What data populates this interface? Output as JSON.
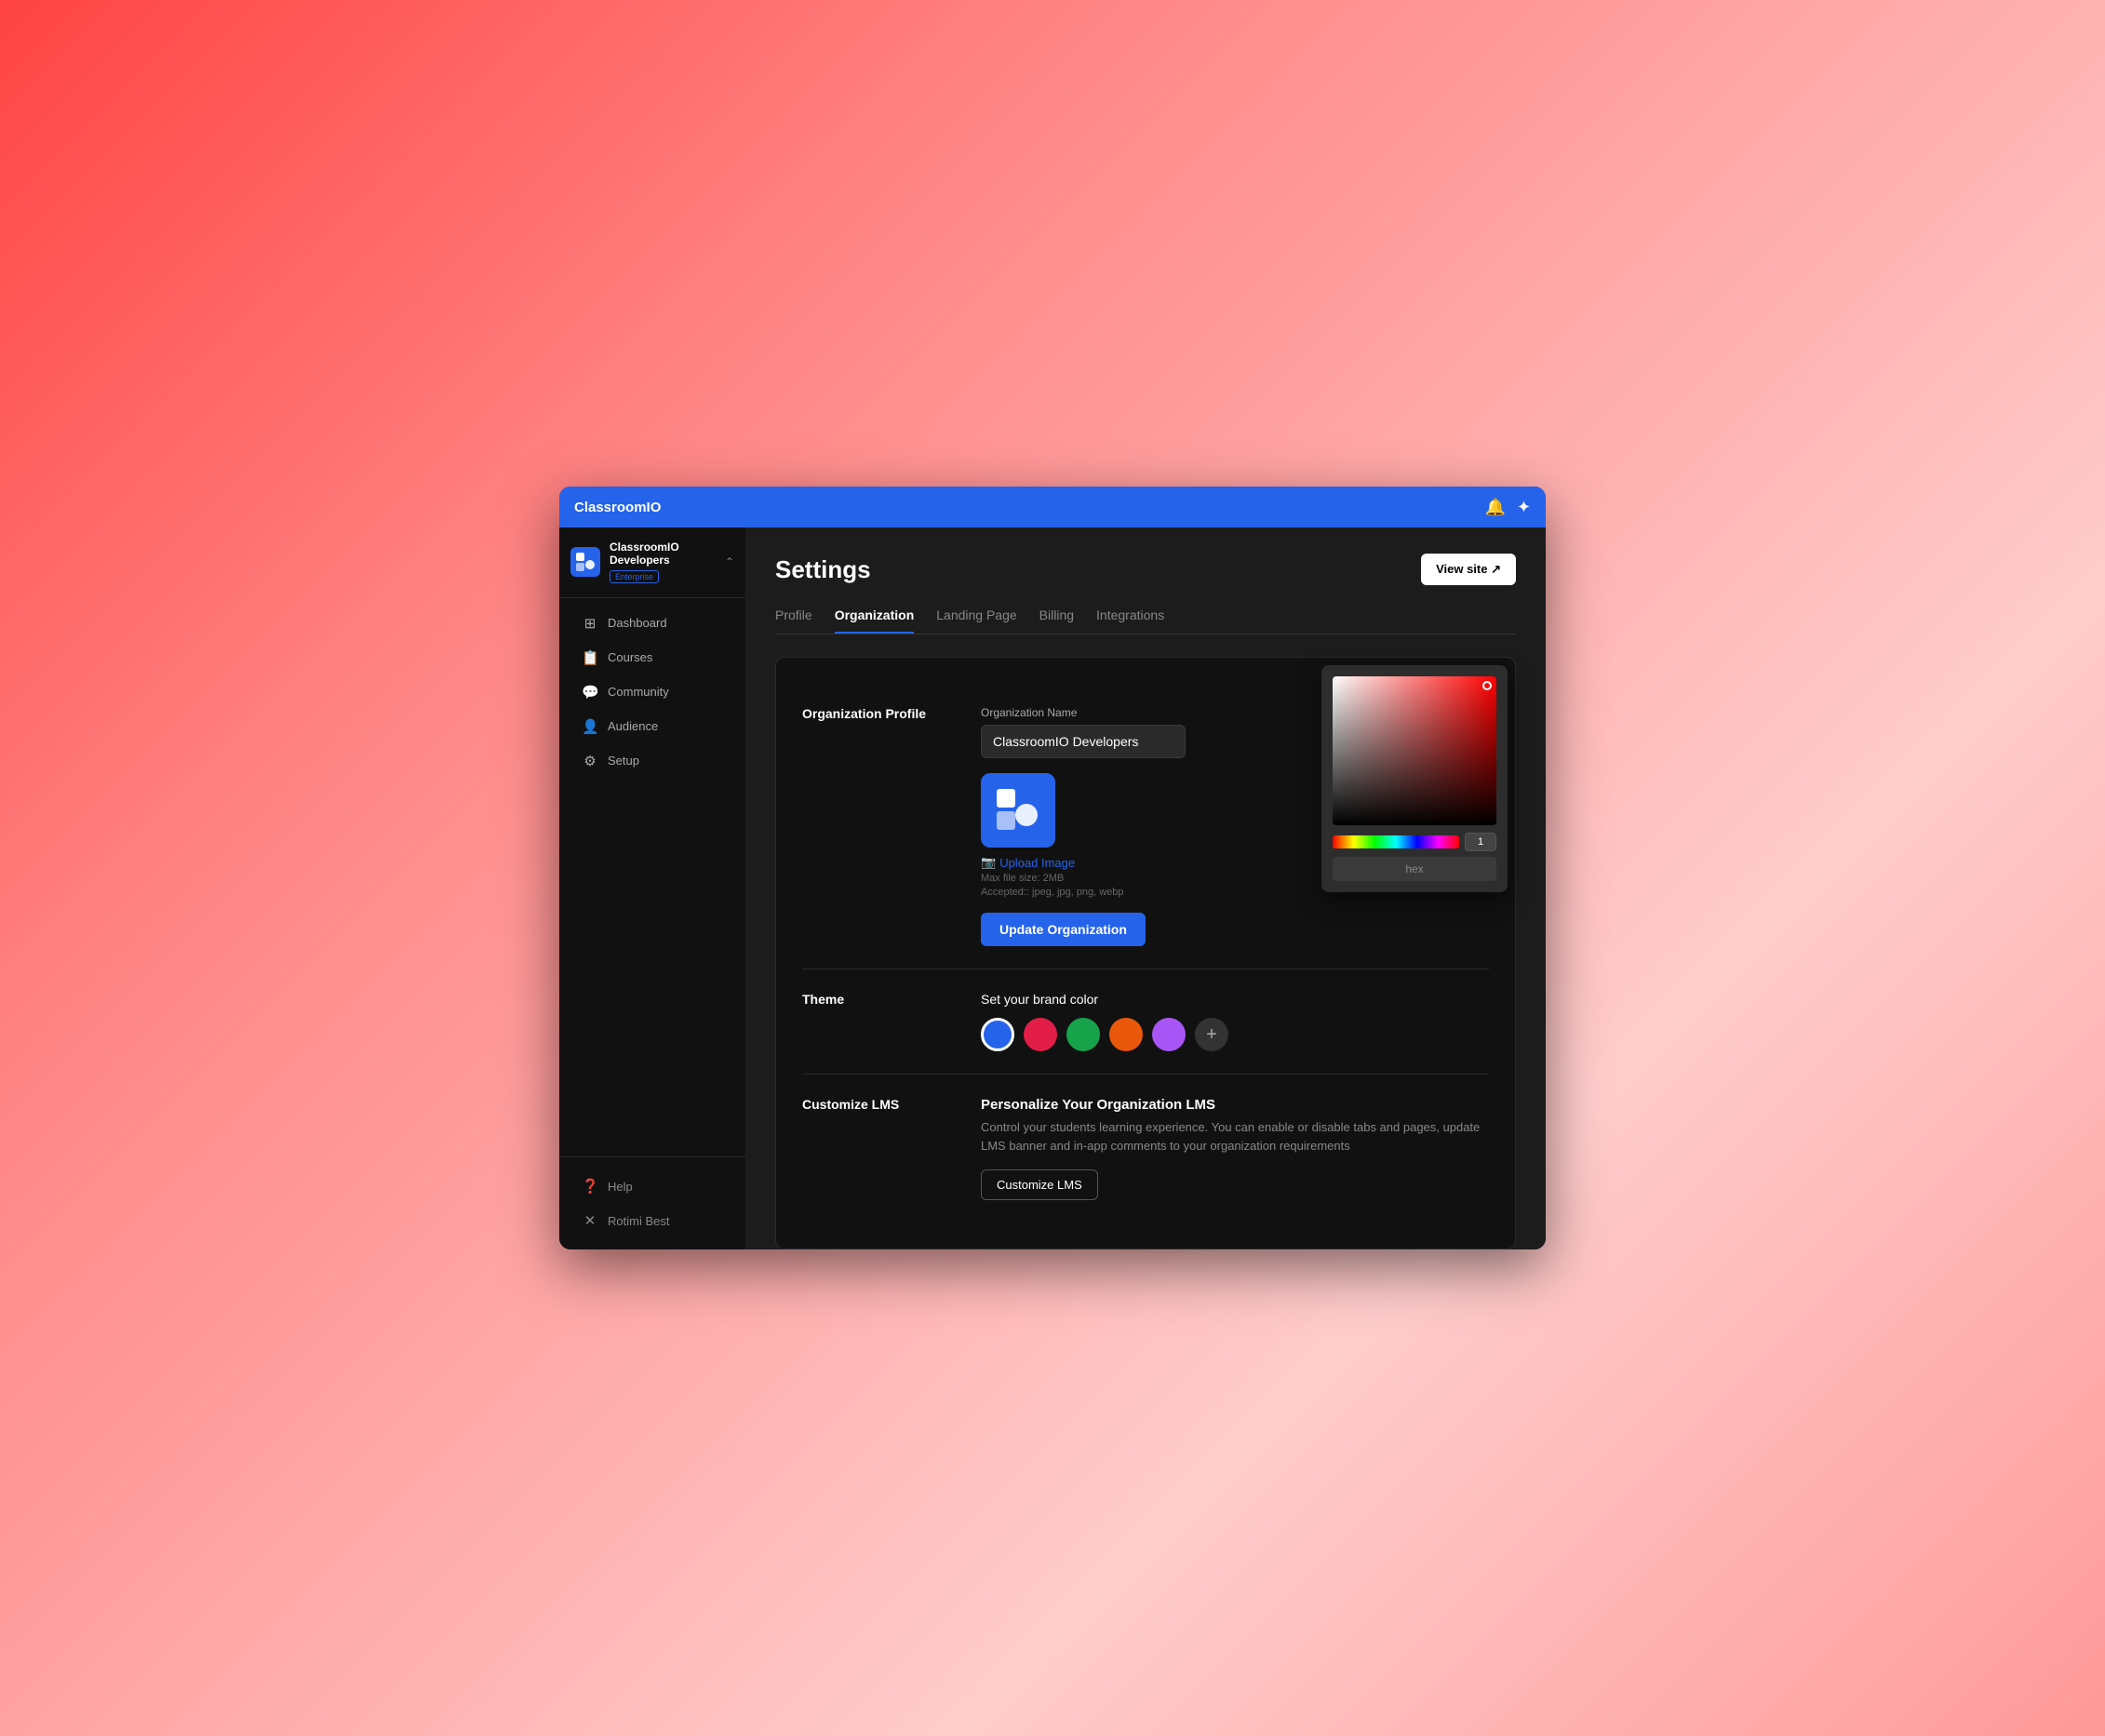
{
  "topbar": {
    "title": "ClassroomIO"
  },
  "sidebar": {
    "org": {
      "name": "ClassroomIO Developers",
      "badge": "Enterprise"
    },
    "navItems": [
      {
        "id": "dashboard",
        "label": "Dashboard",
        "icon": "⊞"
      },
      {
        "id": "courses",
        "label": "Courses",
        "icon": "📄"
      },
      {
        "id": "community",
        "label": "Community",
        "icon": "💬"
      },
      {
        "id": "audience",
        "label": "Audience",
        "icon": "👤"
      },
      {
        "id": "setup",
        "label": "Setup",
        "icon": "⚙"
      }
    ],
    "bottomItems": [
      {
        "id": "help",
        "label": "Help",
        "icon": "?"
      },
      {
        "id": "user",
        "label": "Rotimi Best",
        "icon": "✕"
      }
    ]
  },
  "page": {
    "title": "Settings",
    "viewSiteLabel": "View site ↗"
  },
  "tabs": [
    {
      "id": "profile",
      "label": "Profile"
    },
    {
      "id": "organization",
      "label": "Organization",
      "active": true
    },
    {
      "id": "landing-page",
      "label": "Landing Page"
    },
    {
      "id": "billing",
      "label": "Billing"
    },
    {
      "id": "integrations",
      "label": "Integrations"
    }
  ],
  "orgProfile": {
    "sectionLabel": "Organization Profile",
    "orgNameLabel": "Organization Name",
    "orgNameValue": "ClassroomIO Developers",
    "uploadLabel": "Upload Image",
    "maxFileSize": "Max file size: 2MB",
    "acceptedFormats": "Accepted:: jpeg, jpg, png, webp",
    "updateButtonLabel": "Update Organization"
  },
  "theme": {
    "sectionLabel": "Theme",
    "brandColorLabel": "Set your brand color",
    "colors": [
      {
        "id": "blue",
        "value": "#2563eb",
        "selected": true
      },
      {
        "id": "red",
        "value": "#e11d48"
      },
      {
        "id": "green",
        "value": "#16a34a"
      },
      {
        "id": "orange",
        "value": "#ea580c"
      },
      {
        "id": "purple",
        "value": "#a855f7"
      }
    ]
  },
  "colorPicker": {
    "hexLabel": "hex",
    "opacityValue": "1"
  },
  "customizeLMS": {
    "sectionLabel": "Customize LMS",
    "title": "Personalize Your Organization LMS",
    "description": "Control your students learning experience. You can enable or disable tabs and pages, update LMS banner and in-app comments to your organization requirements",
    "buttonLabel": "Customize LMS"
  }
}
